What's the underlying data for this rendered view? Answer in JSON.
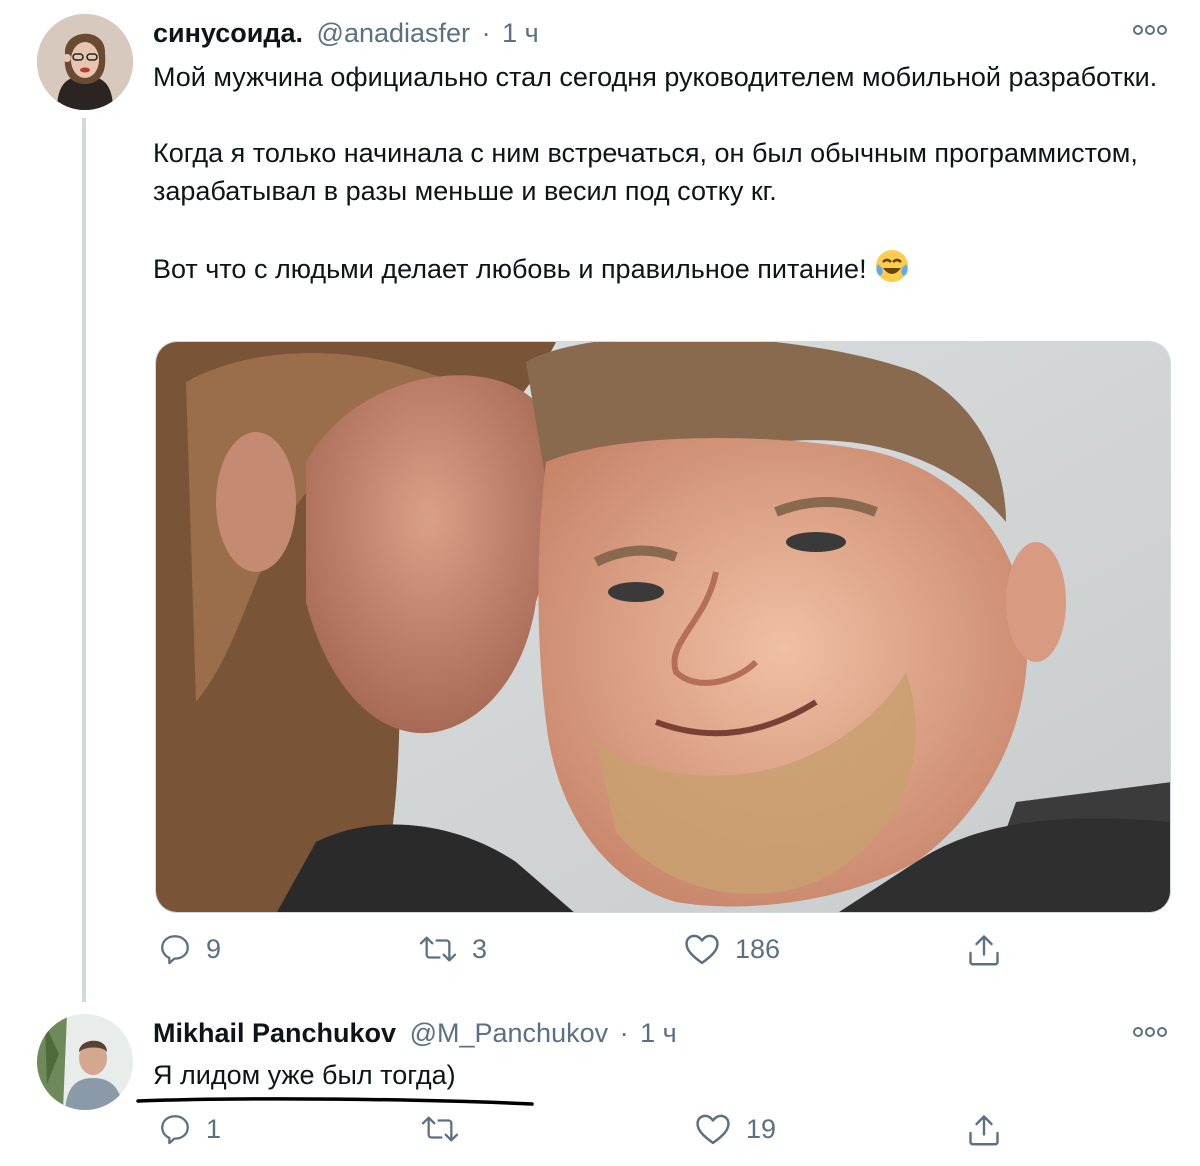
{
  "tweet": {
    "author_name": "синусоида.",
    "author_handle": "@anadiasfer",
    "separator": "·",
    "time": "1 ч",
    "paragraphs": [
      "Мой мужчина официально стал сегодня руководителем мобильной разработки.",
      "Когда я только начинала с ним встречаться, он был обычным программистом, зарабатывал в разы меньше и весил под сотку кг.",
      "Вот что с людьми делает любовь и правильное питание!"
    ],
    "emoji": "😂",
    "actions": {
      "reply_count": "9",
      "retweet_count": "3",
      "like_count": "186"
    }
  },
  "reply": {
    "author_name": "Mikhail Panchukov",
    "author_handle": "@M_Panchukov",
    "separator": "·",
    "time": "1 ч",
    "text": "Я лидом уже был тогда)",
    "actions": {
      "reply_count": "1",
      "retweet_count": "",
      "like_count": "19"
    }
  },
  "icons": {
    "more": "more-horizontal-icon",
    "reply": "reply-bubble-icon",
    "retweet": "retweet-arrows-icon",
    "like": "heart-outline-icon",
    "share": "share-upload-icon",
    "emoji": "face-with-tears-of-joy-emoji"
  },
  "colors": {
    "text": "#0f1419",
    "secondary": "#5b7083",
    "thread_line": "#cfd9de"
  }
}
